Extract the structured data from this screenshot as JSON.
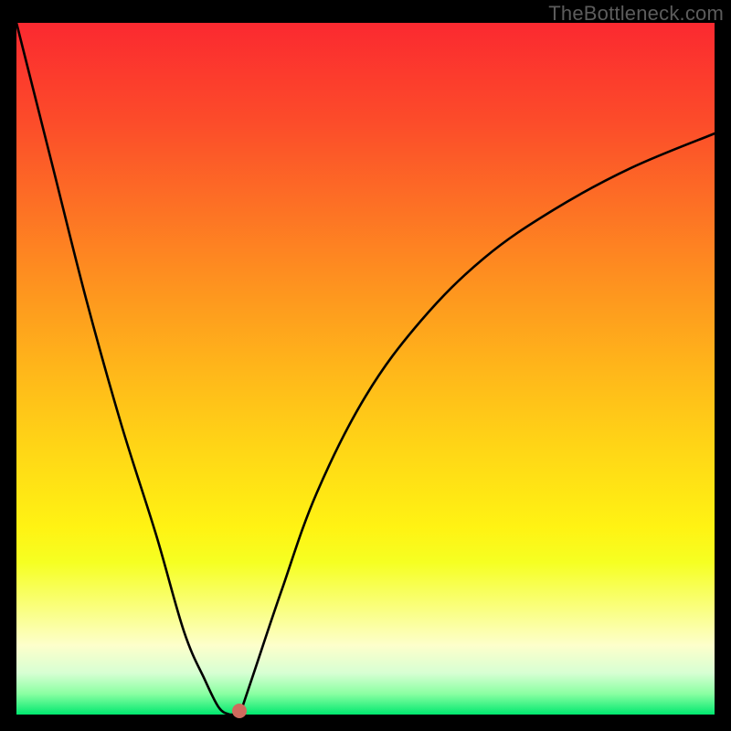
{
  "attribution": "TheBottleneck.com",
  "chart_data": {
    "type": "line",
    "title": "",
    "xlabel": "",
    "ylabel": "",
    "xlim": [
      0,
      100
    ],
    "ylim": [
      0,
      100
    ],
    "series": [
      {
        "name": "left-branch",
        "x": [
          0,
          5,
          10,
          15,
          20,
          24,
          27,
          29,
          30.5
        ],
        "values": [
          100,
          80,
          60,
          42,
          26,
          12,
          5,
          1,
          0
        ]
      },
      {
        "name": "right-branch",
        "x": [
          32,
          34,
          38,
          43,
          50,
          58,
          67,
          77,
          88,
          100
        ],
        "values": [
          0,
          6,
          18,
          32,
          46,
          57,
          66,
          73,
          79,
          84
        ]
      }
    ],
    "marker": {
      "x": 32,
      "y": 0.5
    },
    "gradient_stops": [
      {
        "pos": 0,
        "color": "#fb2930"
      },
      {
        "pos": 50,
        "color": "#ffb61a"
      },
      {
        "pos": 78,
        "color": "#f6ff22"
      },
      {
        "pos": 100,
        "color": "#00e86f"
      }
    ]
  }
}
